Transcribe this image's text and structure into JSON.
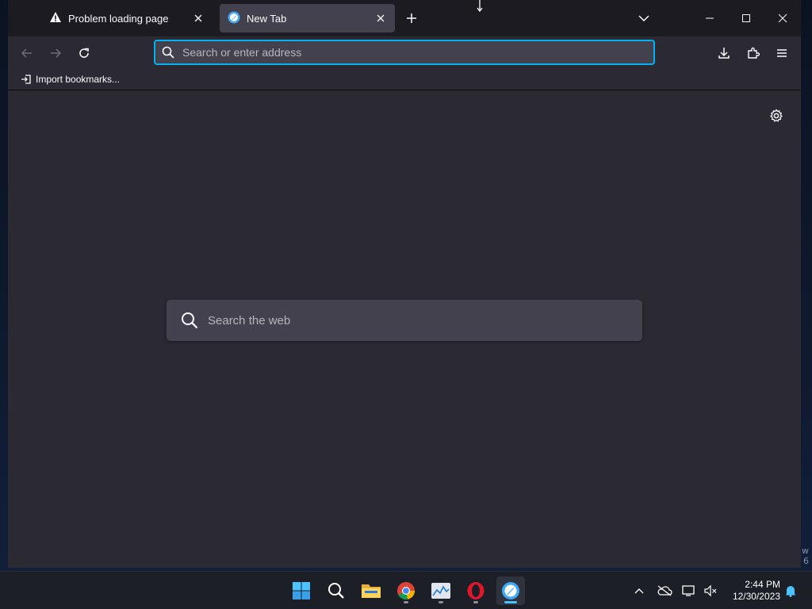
{
  "tabs": [
    {
      "label": "Problem loading page",
      "icon": "warning-icon"
    },
    {
      "label": "New Tab",
      "icon": "browser-logo-icon"
    }
  ],
  "urlbar": {
    "placeholder": "Search or enter address"
  },
  "bookmarks": {
    "import_label": "Import bookmarks..."
  },
  "content": {
    "search_placeholder": "Search the web"
  },
  "desktop": {
    "corner_text_line1": "w",
    "corner_text_line2": "6"
  },
  "taskbar": {
    "apps": [
      "start-icon",
      "search-icon",
      "file-explorer-icon",
      "chrome-icon",
      "task-manager-icon",
      "opera-icon",
      "browser-icon"
    ],
    "time": "2:44 PM",
    "date": "12/30/2023"
  },
  "colors": {
    "accent": "#00b3f4",
    "frame": "#1c1b22",
    "toolbar": "#2b2a33",
    "field": "#42414d",
    "taskbar_accent": "#4cc2ff"
  }
}
